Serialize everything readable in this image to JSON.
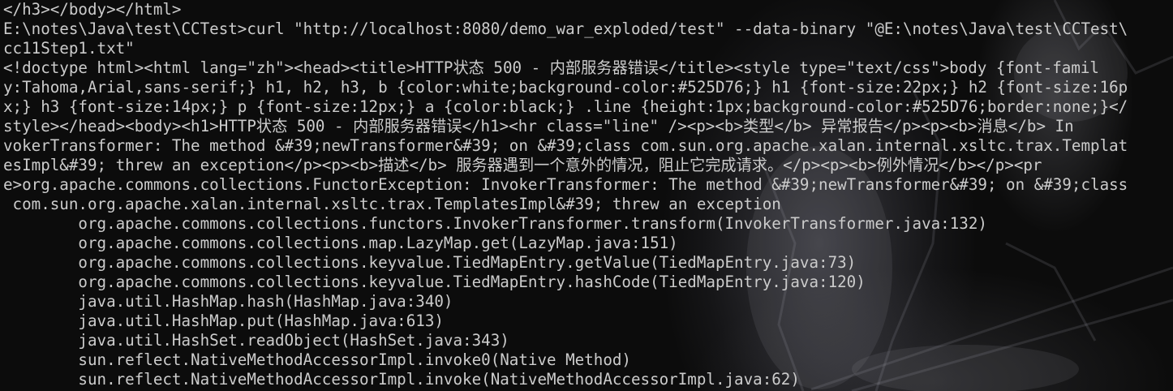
{
  "terminal": {
    "lines": [
      "</h3></body></html>",
      "E:\\notes\\Java\\test\\CCTest>curl \"http://localhost:8080/demo_war_exploded/test\" --data-binary \"@E:\\notes\\Java\\test\\CCTest\\",
      "cc11Step1.txt\"",
      "<!doctype html><html lang=\"zh\"><head><title>HTTP状态 500 - 内部服务器错误</title><style type=\"text/css\">body {font-famil",
      "y:Tahoma,Arial,sans-serif;} h1, h2, h3, b {color:white;background-color:#525D76;} h1 {font-size:22px;} h2 {font-size:16p",
      "x;} h3 {font-size:14px;} p {font-size:12px;} a {color:black;} .line {height:1px;background-color:#525D76;border:none;}</",
      "style></head><body><h1>HTTP状态 500 - 内部服务器错误</h1><hr class=\"line\" /><p><b>类型</b> 异常报告</p><p><b>消息</b> In",
      "vokerTransformer: The method &#39;newTransformer&#39; on &#39;class com.sun.org.apache.xalan.internal.xsltc.trax.Templat",
      "esImpl&#39; threw an exception</p><p><b>描述</b> 服务器遇到一个意外的情况，阻止它完成请求。</p><p><b>例外情况</b></p><pr",
      "e>org.apache.commons.collections.FunctorException: InvokerTransformer: The method &#39;newTransformer&#39; on &#39;class",
      " com.sun.org.apache.xalan.internal.xsltc.trax.TemplatesImpl&#39; threw an exception",
      "        org.apache.commons.collections.functors.InvokerTransformer.transform(InvokerTransformer.java:132)",
      "        org.apache.commons.collections.map.LazyMap.get(LazyMap.java:151)",
      "        org.apache.commons.collections.keyvalue.TiedMapEntry.getValue(TiedMapEntry.java:73)",
      "        org.apache.commons.collections.keyvalue.TiedMapEntry.hashCode(TiedMapEntry.java:120)",
      "        java.util.HashMap.hash(HashMap.java:340)",
      "        java.util.HashMap.put(HashMap.java:613)",
      "        java.util.HashSet.readObject(HashSet.java:343)",
      "        sun.reflect.NativeMethodAccessorImpl.invoke0(Native Method)",
      "        sun.reflect.NativeMethodAccessorImpl.invoke(NativeMethodAccessorImpl.java:62)"
    ],
    "colors": {
      "background": "#0c0c0c",
      "foreground": "#cccccc"
    }
  }
}
